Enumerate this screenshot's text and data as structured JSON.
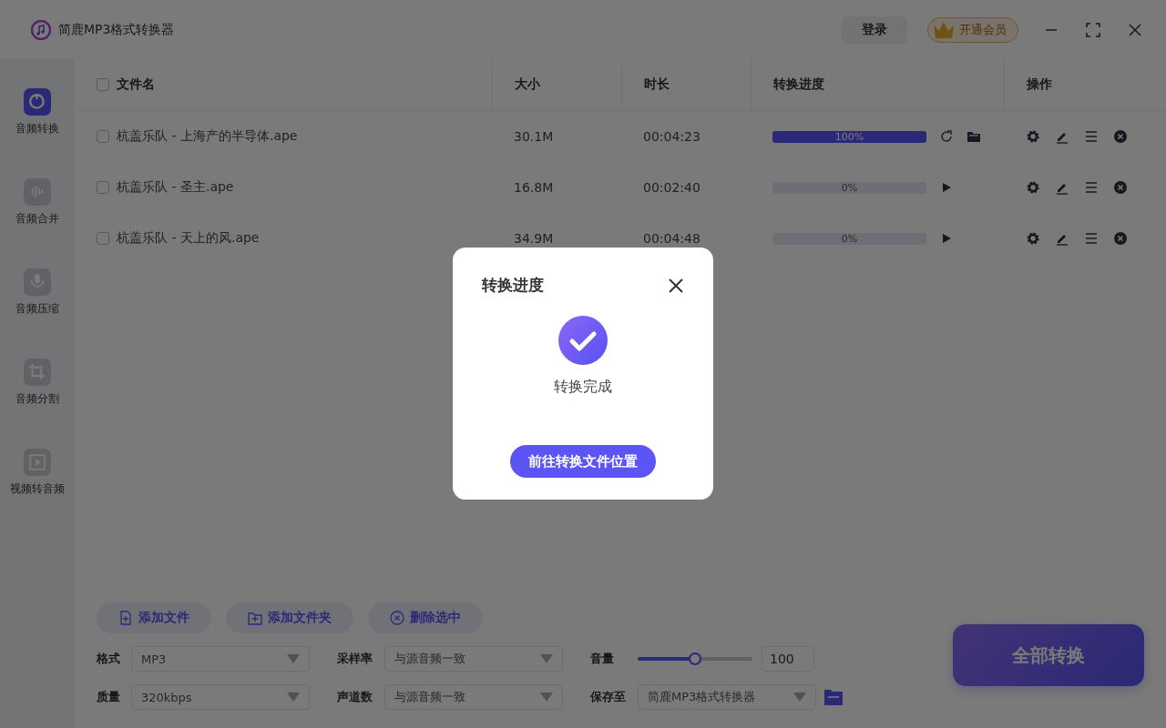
{
  "window": {
    "title": "简鹿MP3格式转换器",
    "login": "登录",
    "vip": "开通会员"
  },
  "sidebar": {
    "items": [
      {
        "label": "音频转换",
        "selected": true
      },
      {
        "label": "音频合并",
        "selected": false
      },
      {
        "label": "音频压缩",
        "selected": false
      },
      {
        "label": "音频分割",
        "selected": false
      },
      {
        "label": "视频转音频",
        "selected": false
      }
    ]
  },
  "table": {
    "select_all": {
      "checked": false
    },
    "columns": [
      "文件名",
      "大小",
      "时长",
      "转换进度",
      "操作"
    ],
    "rows": [
      {
        "checked": false,
        "name": "杭盖乐队 - 上海产的半导体.ape",
        "size": "30.1M",
        "duration": "00:04:23",
        "level": 1,
        "progress": "100%",
        "kind": "done"
      },
      {
        "checked": false,
        "name": "杭盖乐队 - 圣主.ape",
        "size": "16.8M",
        "duration": "00:02:40",
        "level": 0,
        "progress": "0%",
        "kind": "pending"
      },
      {
        "checked": false,
        "name": "杭盖乐队 - 天上的风.ape",
        "size": "34.9M",
        "duration": "00:04:48",
        "level": 0,
        "progress": "0%",
        "kind": "pending"
      }
    ]
  },
  "actions": [
    "添加文件",
    "添加文件夹",
    "删除选中"
  ],
  "settings": {
    "format": {
      "label": "格式",
      "value": "MP3"
    },
    "sample_rate": {
      "label": "采样率",
      "value": "与源音频一致"
    },
    "volume": {
      "label": "音量",
      "level": 0.5,
      "value": "100"
    },
    "quality": {
      "label": "质量",
      "value": "320kbps"
    },
    "channels": {
      "label": "声道数",
      "value": "与源音频一致"
    },
    "save_to": {
      "label": "保存至",
      "value": "简鹿MP3格式转换器"
    }
  },
  "convert_all": "全部转换",
  "dialog": {
    "title": "转换进度",
    "message": "转换完成",
    "button": "前往转换文件位置"
  }
}
